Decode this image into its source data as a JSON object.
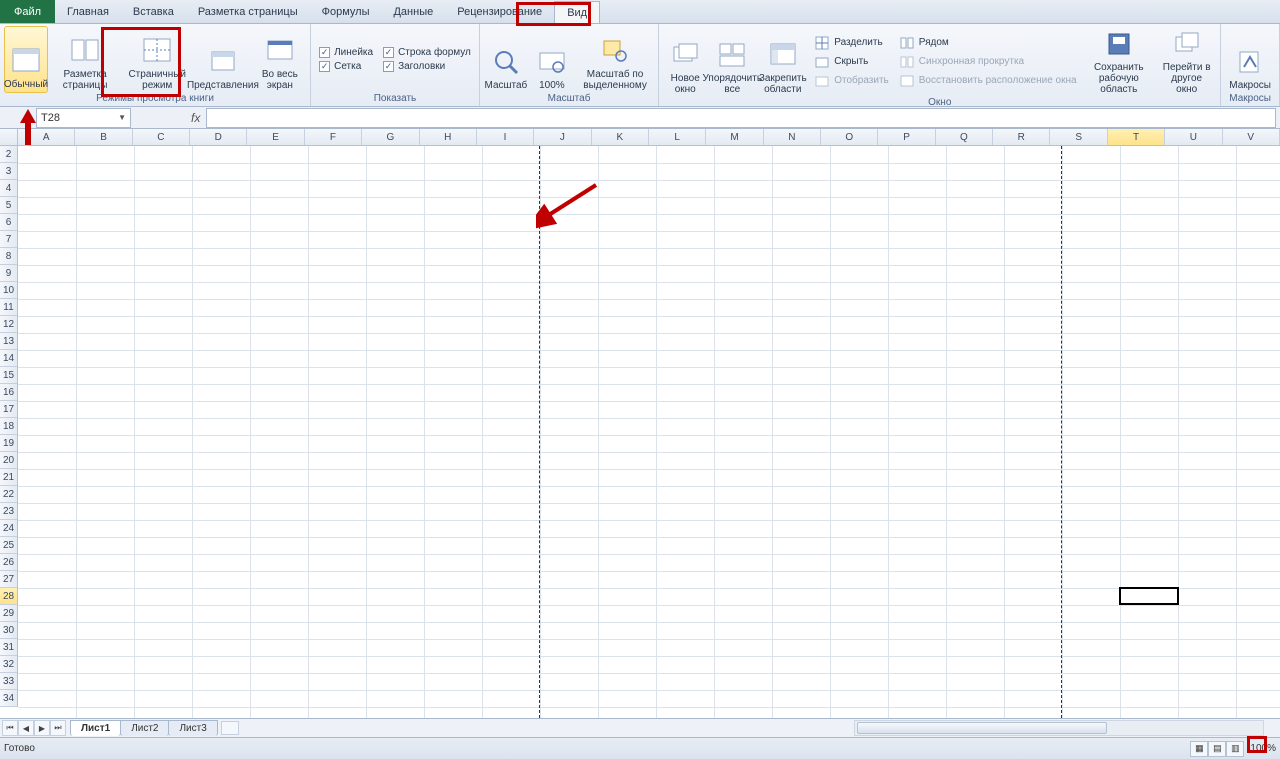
{
  "menubar": {
    "file": "Файл",
    "tabs": [
      "Главная",
      "Вставка",
      "Разметка страницы",
      "Формулы",
      "Данные",
      "Рецензирование",
      "Вид"
    ],
    "active_tab": "Вид"
  },
  "ribbon": {
    "group_view_modes": {
      "label": "Режимы просмотра книги",
      "normal": "Обычный",
      "page_layout": "Разметка страницы",
      "page_break": "Страничный режим",
      "custom_views": "Представления",
      "fullscreen": "Во весь экран"
    },
    "group_show": {
      "label": "Показать",
      "ruler": "Линейка",
      "gridlines": "Сетка",
      "formula_bar": "Строка формул",
      "headings": "Заголовки"
    },
    "group_zoom": {
      "label": "Масштаб",
      "zoom": "Масштаб",
      "hundred": "100%",
      "to_selection": "Масштаб по выделенному"
    },
    "group_window": {
      "label": "Окно",
      "new_window": "Новое окно",
      "arrange": "Упорядочить все",
      "freeze": "Закрепить области",
      "split": "Разделить",
      "hide": "Скрыть",
      "unhide": "Отобразить",
      "side_by_side": "Рядом",
      "sync_scroll": "Синхронная прокрутка",
      "reset_pos": "Восстановить расположение окна",
      "save_workspace": "Сохранить рабочую область",
      "switch_windows": "Перейти в другое окно"
    },
    "group_macros": {
      "label": "Макросы",
      "macros": "Макросы"
    }
  },
  "namebox": {
    "value": "T28"
  },
  "formula_label": "fx",
  "columns": [
    "A",
    "B",
    "C",
    "D",
    "E",
    "F",
    "G",
    "H",
    "I",
    "J",
    "K",
    "L",
    "M",
    "N",
    "O",
    "P",
    "Q",
    "R",
    "S",
    "T",
    "U",
    "V"
  ],
  "rows": [
    2,
    3,
    4,
    5,
    6,
    7,
    8,
    9,
    10,
    11,
    12,
    13,
    14,
    15,
    16,
    17,
    18,
    19,
    20,
    21,
    22,
    23,
    24,
    25,
    26,
    27,
    28,
    29,
    30,
    31,
    32,
    33,
    34
  ],
  "active_cell": {
    "col": "T",
    "row": 28
  },
  "selected_col": "T",
  "selected_row": 28,
  "sheets": {
    "list": [
      "Лист1",
      "Лист2",
      "Лист3"
    ],
    "active": "Лист1"
  },
  "status": {
    "ready": "Готово",
    "zoom": "100%"
  }
}
